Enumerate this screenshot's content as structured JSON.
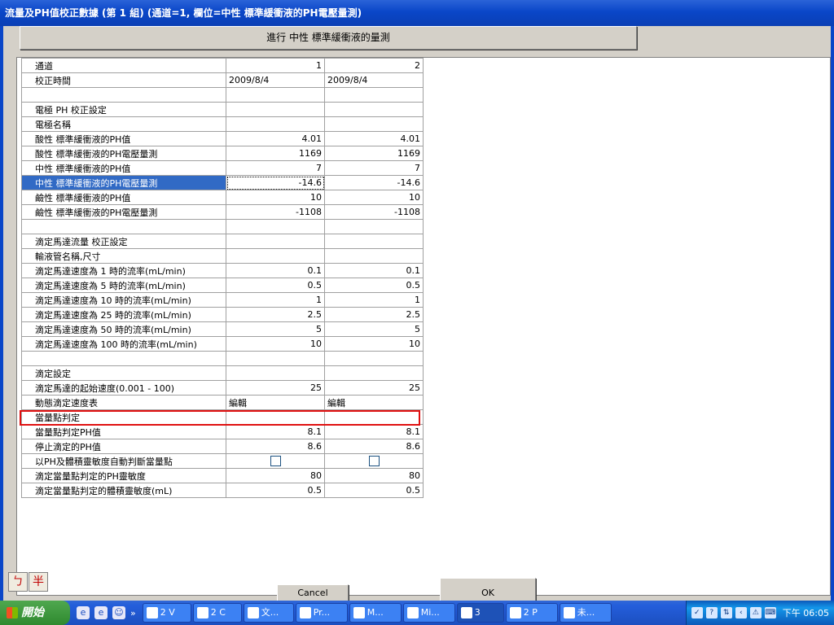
{
  "window": {
    "title": "流量及PH值校正數據 (第 1 組) (通道=1, 欄位=中性 標準緩衝液的PH電壓量測)",
    "action_button": "進行 中性 標準緩衝液的量測"
  },
  "grid": {
    "rows": [
      {
        "label": "通道",
        "v1": "1",
        "v2": "2"
      },
      {
        "label": "校正時間",
        "v1": "2009/8/4",
        "v2": "2009/8/4",
        "align": "left"
      },
      {
        "label": "",
        "v1": "",
        "v2": ""
      },
      {
        "label": "電極 PH 校正設定",
        "v1": "",
        "v2": ""
      },
      {
        "label": "電極名稱",
        "v1": "",
        "v2": ""
      },
      {
        "label": "酸性 標準緩衝液的PH值",
        "v1": "4.01",
        "v2": "4.01"
      },
      {
        "label": "酸性 標準緩衝液的PH電壓量測",
        "v1": "1169",
        "v2": "1169"
      },
      {
        "label": "中性 標準緩衝液的PH值",
        "v1": "7",
        "v2": "7"
      },
      {
        "label": "中性 標準緩衝液的PH電壓量測",
        "v1": "-14.6",
        "v2": "-14.6",
        "selected": true
      },
      {
        "label": "鹼性 標準緩衝液的PH值",
        "v1": "10",
        "v2": "10"
      },
      {
        "label": "鹼性 標準緩衝液的PH電壓量測",
        "v1": "-1108",
        "v2": "-1108"
      },
      {
        "label": "",
        "v1": "",
        "v2": ""
      },
      {
        "label": "滴定馬達流量 校正設定",
        "v1": "",
        "v2": ""
      },
      {
        "label": "輸液管名稱,尺寸",
        "v1": "",
        "v2": ""
      },
      {
        "label": "滴定馬達速度為 1 時的流率(mL/min)",
        "v1": "0.1",
        "v2": "0.1"
      },
      {
        "label": "滴定馬達速度為 5 時的流率(mL/min)",
        "v1": "0.5",
        "v2": "0.5"
      },
      {
        "label": "滴定馬達速度為 10 時的流率(mL/min)",
        "v1": "1",
        "v2": "1"
      },
      {
        "label": "滴定馬達速度為 25 時的流率(mL/min)",
        "v1": "2.5",
        "v2": "2.5"
      },
      {
        "label": "滴定馬達速度為 50 時的流率(mL/min)",
        "v1": "5",
        "v2": "5"
      },
      {
        "label": "滴定馬達速度為 100 時的流率(mL/min)",
        "v1": "10",
        "v2": "10"
      },
      {
        "label": "",
        "v1": "",
        "v2": ""
      },
      {
        "label": "滴定設定",
        "v1": "",
        "v2": ""
      },
      {
        "label": "滴定馬達的起始速度(0.001 - 100)",
        "v1": "25",
        "v2": "25"
      },
      {
        "label": "動態滴定速度表",
        "v1": "編輯",
        "v2": "編輯",
        "align": "left"
      },
      {
        "label": "當量點判定",
        "v1": "",
        "v2": ""
      },
      {
        "label": "當量點判定PH值",
        "v1": "8.1",
        "v2": "8.1"
      },
      {
        "label": "停止滴定的PH值",
        "v1": "8.6",
        "v2": "8.6"
      },
      {
        "label": "以PH及體積靈敏度自動判斷當量點",
        "checkbox": true
      },
      {
        "label": "滴定當量點判定的PH靈敏度",
        "v1": "80",
        "v2": "80"
      },
      {
        "label": "滴定當量點判定的體積靈敏度(mL)",
        "v1": "0.5",
        "v2": "0.5"
      }
    ]
  },
  "ime": {
    "key1": "ㄅ",
    "key2": "半"
  },
  "buttons": {
    "cancel": "Cancel",
    "ok": "OK"
  },
  "taskbar": {
    "start": "開始",
    "items": [
      "2 V",
      "2 C",
      "文...",
      "Pr...",
      "M...",
      "Mi...",
      "3",
      "2 P",
      "未..."
    ],
    "clock": "下午 06:05"
  }
}
